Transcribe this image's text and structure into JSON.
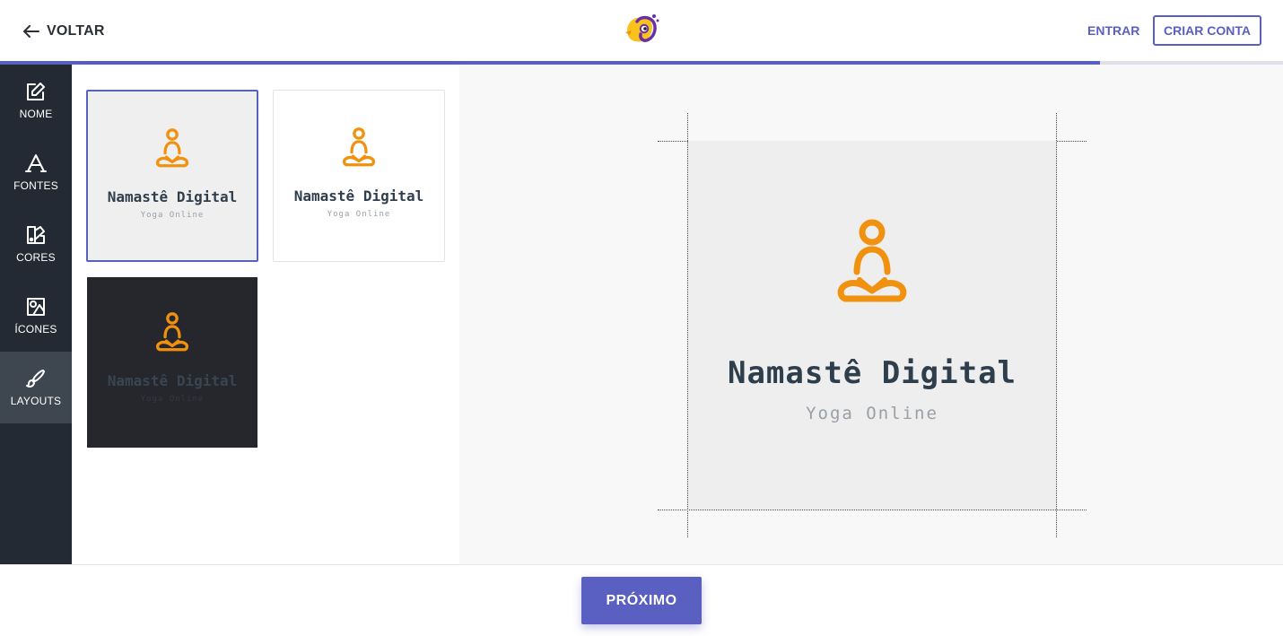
{
  "header": {
    "back_label": "VOLTAR",
    "back_icon": "arrow-left-icon",
    "logo_icon": "bird-logo-icon",
    "login_label": "ENTRAR",
    "signup_label": "CRIAR CONTA"
  },
  "progress": {
    "fraction": 0.857
  },
  "sidebar": {
    "items": [
      {
        "label": "NOME",
        "icon": "edit-icon"
      },
      {
        "label": "FONTES",
        "icon": "font-icon"
      },
      {
        "label": "CORES",
        "icon": "palette-icon"
      },
      {
        "label": "ÍCONES",
        "icon": "shapes-icon"
      },
      {
        "label": "LAYOUTS",
        "icon": "brush-icon"
      }
    ],
    "active_index": 4
  },
  "layouts": {
    "cards": [
      {
        "name": "Namastê Digital",
        "subtitle": "Yoga Online",
        "background": "#efefef",
        "selected": true
      },
      {
        "name": "Namastê Digital",
        "subtitle": "Yoga Online",
        "background": "#ffffff",
        "selected": false
      },
      {
        "name": "Namastê Digital",
        "subtitle": "Yoga Online",
        "background": "#26272c",
        "selected": false
      }
    ]
  },
  "preview": {
    "name": "Namastê Digital",
    "subtitle": "Yoga Online",
    "icon": "yoga-meditation-icon"
  },
  "footer": {
    "next_label": "PRÓXIMO"
  },
  "colors": {
    "accent": "#5a5fc2",
    "sidebar_bg": "#232a33",
    "sidebar_active": "#3e4650",
    "icon_orange": "#f0920f",
    "logo_yellow": "#f6c21b",
    "logo_purple": "#6b2fa5",
    "text_dark": "#2f3e4d"
  }
}
